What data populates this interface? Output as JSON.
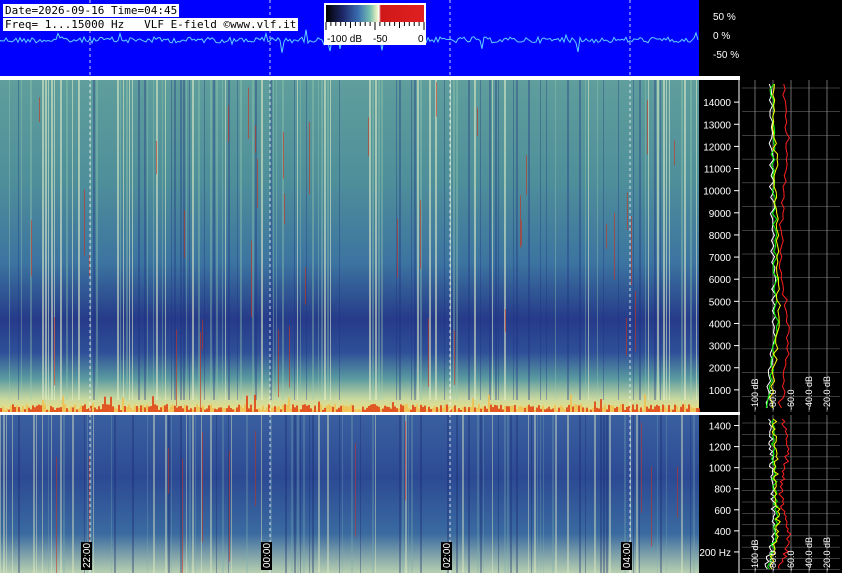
{
  "header": {
    "line1": "Date=2026-09-16 Time=04:45",
    "line2": "Freq= 1...15000 Hz   VLF E-field ©www.vlf.it"
  },
  "colorbar": {
    "labels": [
      "-100 dB",
      "-50",
      "0"
    ],
    "colors": [
      "#000000",
      "#1f2a6e",
      "#3a6fb0",
      "#78c0b0",
      "#e8f0c0",
      "#ffffff",
      "#d01818",
      "#e02020"
    ]
  },
  "waveform": {
    "pct_labels": [
      "50 %",
      "0 %",
      "-50 %"
    ],
    "bg_color": "#0000ff",
    "trace_color": "#5fd0ff"
  },
  "chart_data": [
    {
      "type": "heatmap",
      "name": "upper",
      "title": "",
      "ylim": [
        0,
        15000
      ],
      "yticks": [
        1000,
        2000,
        3000,
        4000,
        5000,
        6000,
        7000,
        8000,
        9000,
        10000,
        11000,
        12000,
        13000,
        14000
      ],
      "ytick_labels": [
        "1000",
        "2000",
        "3000",
        "4000",
        "5000",
        "6000",
        "7000",
        "8000",
        "9000",
        "10000",
        "11000",
        "12000",
        "13000",
        "14000"
      ]
    },
    {
      "type": "heatmap",
      "name": "lower",
      "title": "",
      "ylim": [
        0,
        1500
      ],
      "yticks": [
        200,
        400,
        600,
        800,
        1000,
        1200,
        1400
      ],
      "ytick_labels": [
        "200 Hz",
        "400",
        "600",
        "800",
        "1000",
        "1200",
        "1400"
      ]
    },
    {
      "type": "line",
      "name": "spectrum-profile",
      "xlabels_upper": [
        "-100 dB",
        "-80.0",
        "-60.0",
        "-40.0 dB",
        "-20.0 dB"
      ],
      "xlabels_lower": [
        "-100 dB",
        "-80.0",
        "-60.0",
        "-40.0 dB",
        "-20.0 dB"
      ],
      "series_colors": [
        "#ffffff",
        "#00ff00",
        "#ffff00",
        "#ff2020"
      ]
    }
  ],
  "time_axis": {
    "labels": [
      "22:00",
      "00:00",
      "02:00",
      "04:00"
    ]
  }
}
